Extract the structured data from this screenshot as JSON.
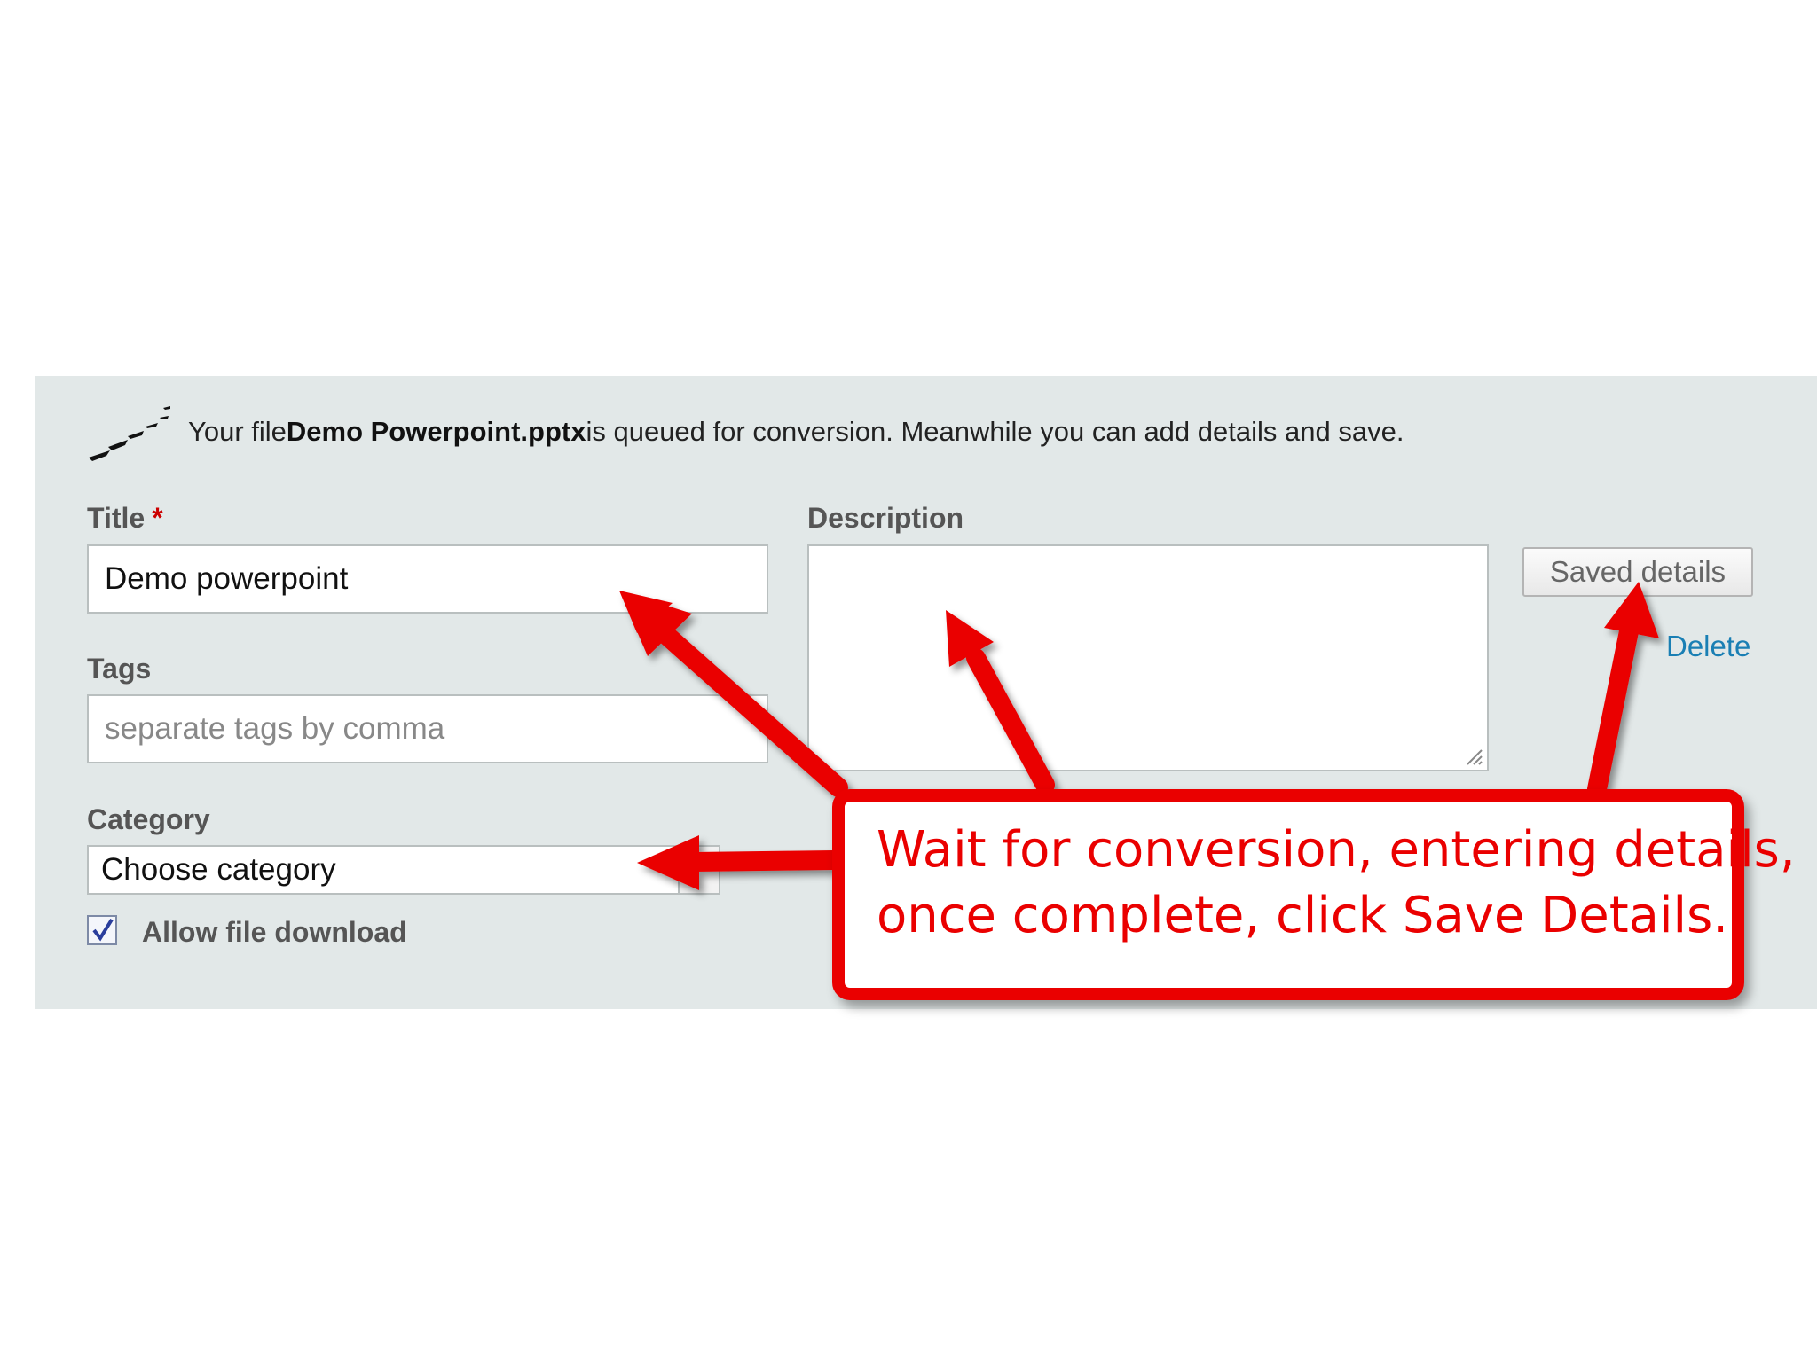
{
  "upload_notice": {
    "prefix": "Your file ",
    "filename": "Demo Powerpoint.pptx",
    "suffix": " is queued for conversion. Meanwhile you can add details and save."
  },
  "form": {
    "title_label": "Title",
    "required_mark": "*",
    "title_value": "Demo powerpoint",
    "tags_label": "Tags",
    "tags_placeholder": "separate tags by comma",
    "category_label": "Category",
    "category_value": "Choose category",
    "allow_download_label": "Allow file download",
    "allow_download_checked": true,
    "description_label": "Description",
    "description_value": "",
    "save_button_label": "Saved details",
    "delete_link_label": "Delete"
  },
  "annotation": {
    "line1": "Wait for conversion, entering details,",
    "line2": "once complete, click Save Details."
  },
  "colors": {
    "panel": "#e2e8e8",
    "annotation_red": "#ea0000",
    "link_blue": "#1a7fb4"
  },
  "icons": [
    "loading-spinner-icon",
    "checkbox-check-icon",
    "resize-grip-icon",
    "select-arrow-icon"
  ]
}
